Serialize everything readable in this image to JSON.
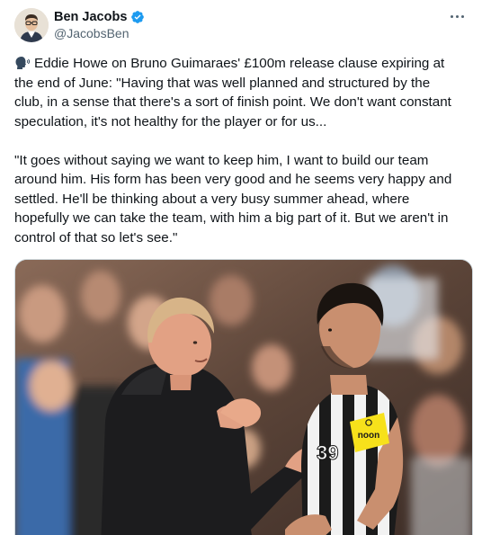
{
  "author": {
    "display_name": "Ben Jacobs",
    "handle": "@JacobsBen",
    "verified": true,
    "verified_color": "#1d9bf0",
    "avatar_icon": "person-avatar"
  },
  "more_icon": "ellipsis-icon",
  "tweet": {
    "paragraph1_lines": [
      "Eddie Howe on Bruno Guimaraes' £100m release clause expiring at",
      "the end of June: \"Having that was well planned and structured by the",
      "club, in a sense that there's a sort of finish point. We don't want constant",
      "speculation, it's not healthy for the player or for us..."
    ],
    "paragraph2_lines": [
      "\"It goes without saying we want to keep him, I want to build our team",
      "around him. His form has been very good and he seems very happy and",
      "settled. He'll be thinking about a very busy summer ahead, where",
      "hopefully we can take the team, with him a big part of it. But we aren't in",
      "control of that so let's see.\""
    ],
    "lead_icon": "speaking-head-icon"
  },
  "media": {
    "sponsor_text": "noon",
    "kit_number": "39"
  },
  "colors": {
    "text": "#0f1419",
    "secondary": "#536471",
    "border": "#cfd9de",
    "sponsor": "#f7e11b"
  }
}
